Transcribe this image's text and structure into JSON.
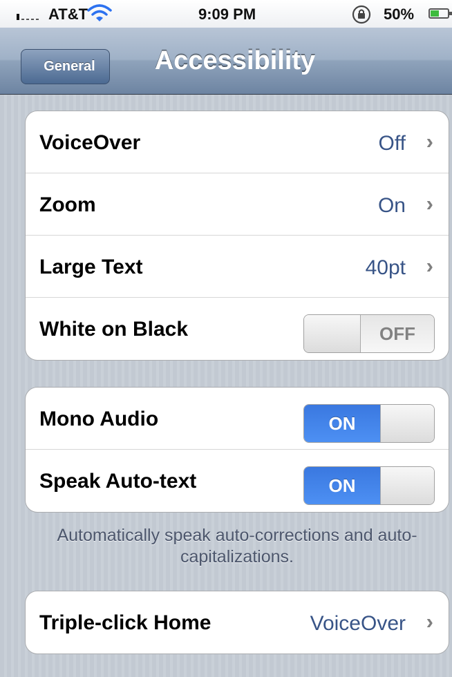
{
  "status_bar": {
    "carrier": "AT&T",
    "time": "9:09 PM",
    "battery_percent": "50%",
    "battery_level": 0.5
  },
  "nav": {
    "back_label": "General",
    "title": "Accessibility"
  },
  "group1": [
    {
      "label": "VoiceOver",
      "value": "Off"
    },
    {
      "label": "Zoom",
      "value": "On"
    },
    {
      "label": "Large Text",
      "value": "40pt"
    },
    {
      "label": "White on Black",
      "switch": "OFF"
    }
  ],
  "group2": [
    {
      "label": "Mono Audio",
      "switch": "ON"
    },
    {
      "label": "Speak Auto-text",
      "switch": "ON"
    }
  ],
  "group2_footer": "Automatically speak auto-corrections and auto-capitalizations.",
  "group3": [
    {
      "label": "Triple-click Home",
      "value": "VoiceOver"
    }
  ],
  "colors": {
    "switch_on": "#3a78e0",
    "detail_value": "#385487",
    "nav_bar": "#6d84a2"
  },
  "icons": {
    "wifi": "wifi-icon",
    "rotation_lock": "rotation-lock-icon",
    "battery": "battery-icon",
    "chevron": "chevron-right-icon"
  }
}
